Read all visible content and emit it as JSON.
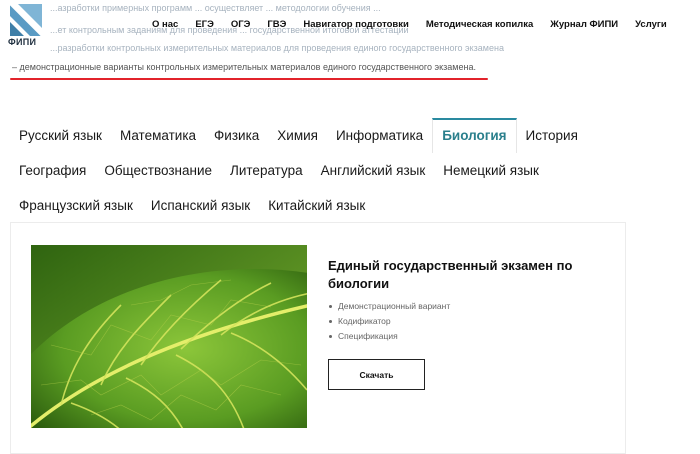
{
  "header": {
    "logo_text": "ФИПИ",
    "bg_lines": [
      "...азработки примерных программ ... осуществляет ... методологии обучения ...",
      "...ет контрольным заданиям для проведения ... государственной итоговой аттестации",
      "...разработки контрольных измерительных материалов для проведения единого государственного экзамена"
    ],
    "nav": [
      "О нас",
      "ЕГЭ",
      "ОГЭ",
      "ГВЭ",
      "Навигатор подготовки",
      "Методическая копилка",
      "Журнал ФИПИ",
      "Услуги"
    ]
  },
  "intro": {
    "line": "– демонстрационные варианты контрольных измерительных материалов единого государственного экзамена."
  },
  "tabs": {
    "row1": [
      "Русский язык",
      "Математика",
      "Физика",
      "Химия",
      "Информатика",
      "Биология",
      "История"
    ],
    "row2": [
      "География",
      "Обществознание",
      "Литература",
      "Английский язык",
      "Немецкий язык"
    ],
    "row3": [
      "Французский язык",
      "Испанский язык",
      "Китайский язык"
    ],
    "active": "Биология"
  },
  "card": {
    "title": "Единый государственный экзамен по биологии",
    "items": [
      "Демонстрационный вариант",
      "Кодификатор",
      "Спецификация"
    ],
    "button": "Скачать",
    "image": "leaf-image"
  },
  "colors": {
    "accent": "#2a8aa0",
    "underline": "#e2232b",
    "logo": "#5a9bc4"
  }
}
